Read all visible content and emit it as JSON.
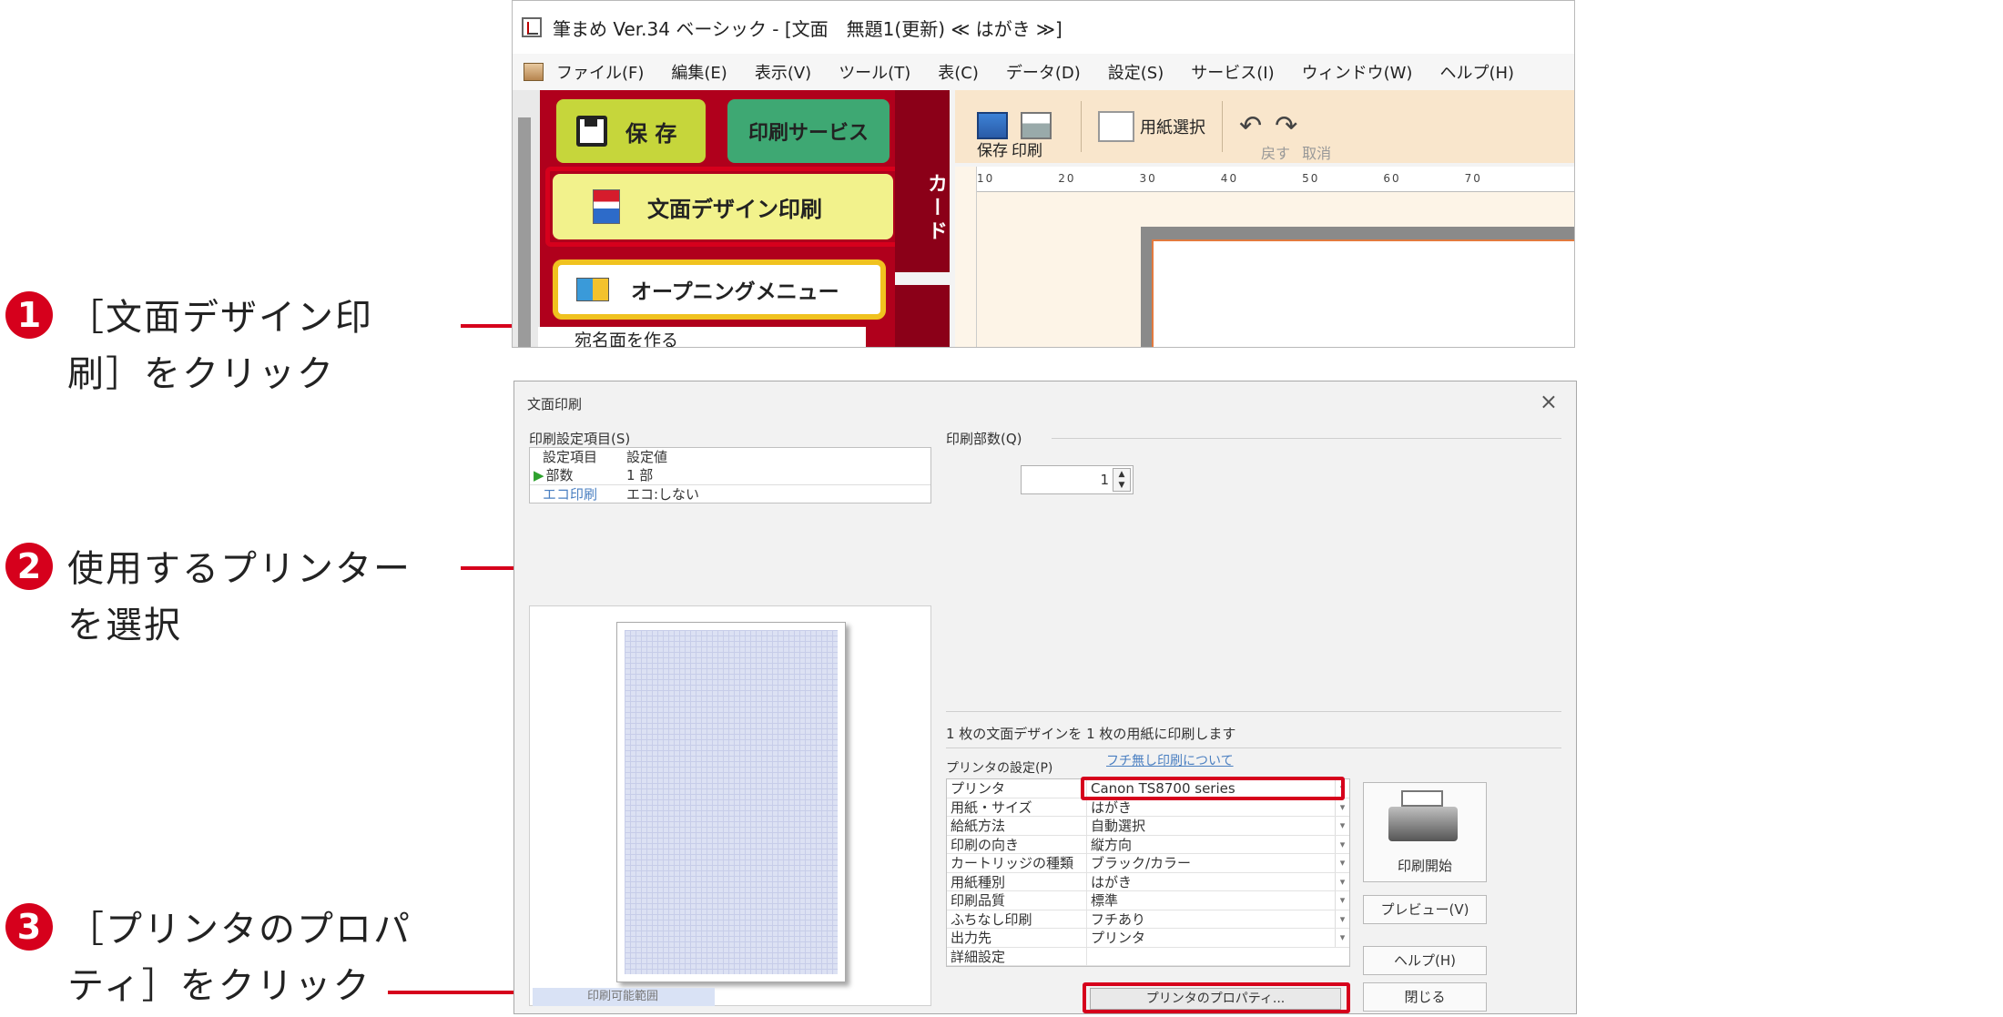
{
  "steps": [
    {
      "num": "1",
      "text": "［文面デザイン印\n刷］をクリック"
    },
    {
      "num": "2",
      "text": "使用するプリンター\nを選択"
    },
    {
      "num": "3",
      "text": "［プリンタのプロパ\nティ］をクリック"
    }
  ],
  "colors": {
    "accent": "#d6001c",
    "panel_red": "#b0001c",
    "save_green": "#c6d63b",
    "service_green": "#3ea873",
    "design_yellow": "#f2f28c"
  },
  "app_window": {
    "title": "筆まめ Ver.34 ベーシック - [文面　無題1(更新) ≪ はがき ≫]",
    "menu": [
      "ファイル(F)",
      "編集(E)",
      "表示(V)",
      "ツール(T)",
      "表(C)",
      "データ(D)",
      "設定(S)",
      "サービス(I)",
      "ウィンドウ(W)",
      "ヘルプ(H)"
    ],
    "panel": {
      "save": "保 存",
      "print_service": "印刷サービス",
      "design_print": "文面デザイン印刷",
      "opening_menu": "オープニングメニュー",
      "address_side": "宛名面を作る",
      "card_tab": "カード"
    },
    "toolbar": {
      "save": "保存",
      "print": "印刷",
      "paper_select": "用紙選択",
      "undo": "戻す",
      "cancel": "取消"
    },
    "ruler_marks": "10　　　　　20　　　　　30　　　　　40　　　　　50　　　　　60　　　　　70"
  },
  "dialog": {
    "title": "文面印刷",
    "close_icon": "×",
    "settings_label": "印刷設定項目(S)",
    "copies_label": "印刷部数(Q)",
    "settings_table": {
      "headers": [
        "設定項目",
        "設定値"
      ],
      "rows": [
        {
          "key": "部数",
          "value": "1 部"
        },
        {
          "key": "エコ印刷",
          "value": "エコ:しない"
        }
      ]
    },
    "copies_value": "1",
    "preview_caption": "印刷可能範囲",
    "info": "1 枚の文面デザインを 1 枚の用紙に印刷します",
    "printer_settings_label": "プリンタの設定(P)",
    "borderless_link": "フチ無し印刷について",
    "printer_rows": [
      {
        "key": "プリンタ",
        "value": "Canon TS8700 series"
      },
      {
        "key": "用紙・サイズ",
        "value": "はがき"
      },
      {
        "key": "給紙方法",
        "value": "自動選択"
      },
      {
        "key": "印刷の向き",
        "value": "縦方向"
      },
      {
        "key": "カートリッジの種類",
        "value": "ブラック/カラー"
      },
      {
        "key": "用紙種別",
        "value": "はがき"
      },
      {
        "key": "印刷品質",
        "value": "標準"
      },
      {
        "key": "ふちなし印刷",
        "value": "フチあり"
      },
      {
        "key": "出力先",
        "value": "プリンタ"
      },
      {
        "key": "詳細設定",
        "value": ""
      }
    ],
    "properties_button": "プリンタのプロパティ...",
    "start_button": "印刷開始",
    "preview_button": "プレビュー(V)",
    "help_button": "ヘルプ(H)",
    "close_button": "閉じる"
  }
}
